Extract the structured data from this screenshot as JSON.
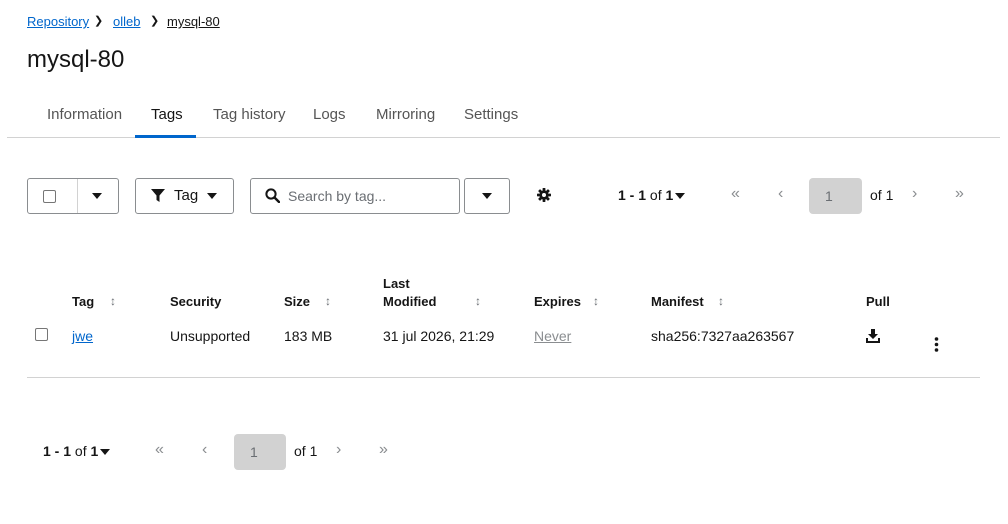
{
  "breadcrumb": {
    "items": [
      "Repository",
      "olleb"
    ],
    "current": "mysql-80"
  },
  "page": {
    "title": "mysql-80"
  },
  "tabs": [
    {
      "label": "Information",
      "active": false
    },
    {
      "label": "Tags",
      "active": true
    },
    {
      "label": "Tag history",
      "active": false
    },
    {
      "label": "Logs",
      "active": false
    },
    {
      "label": "Mirroring",
      "active": false
    },
    {
      "label": "Settings",
      "active": false
    }
  ],
  "toolbar": {
    "filter_label": "Tag",
    "search_placeholder": "Search by tag...",
    "pagination": {
      "range": "1 - 1",
      "of_word": "of",
      "total": "1",
      "page": "1",
      "of_pages": "of 1"
    }
  },
  "table": {
    "headers": {
      "tag": "Tag",
      "security": "Security",
      "size": "Size",
      "last_modified_1": "Last",
      "last_modified_2": "Modified",
      "expires": "Expires",
      "manifest": "Manifest",
      "pull": "Pull"
    },
    "rows": [
      {
        "tag": "jwe",
        "security": "Unsupported",
        "size": "183 MB",
        "last_modified": "31 jul 2026, 21:29",
        "expires": "Never",
        "manifest": "sha256:7327aa263567",
        "pull_icon": "download-icon",
        "actions_icon": "kebab-icon"
      }
    ]
  },
  "bottom_pagination": {
    "range": "1 - 1",
    "of_word": "of",
    "total": "1",
    "page": "1",
    "of_pages": "of 1"
  },
  "colors": {
    "link": "#0066cc",
    "active_tab": "#0066cc",
    "border": "#8a8d90"
  }
}
